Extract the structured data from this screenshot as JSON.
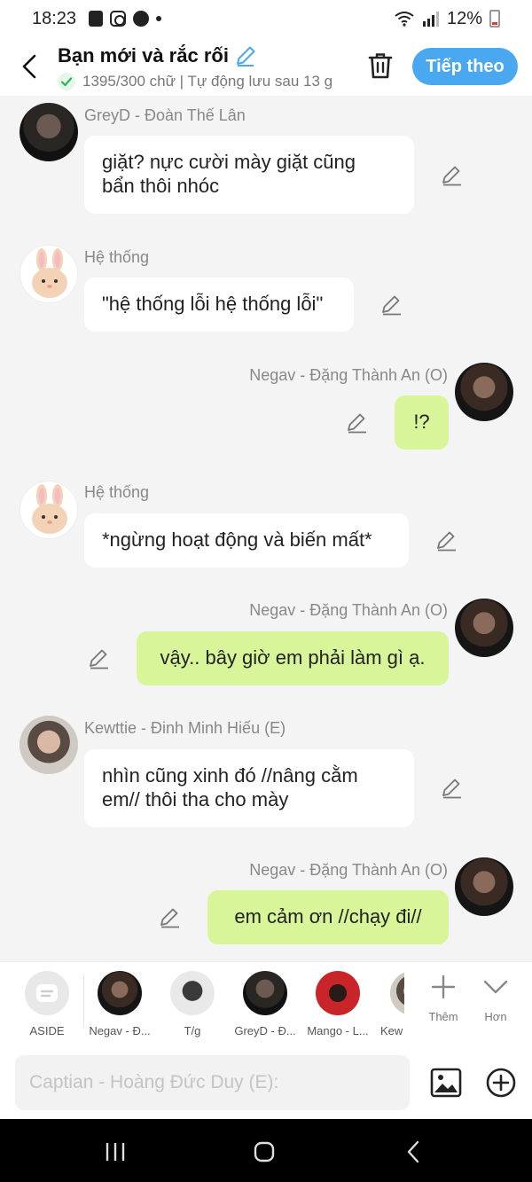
{
  "status": {
    "time": "18:23",
    "battery": "12%"
  },
  "header": {
    "title": "Bạn mới và rắc rối",
    "subtitle": "1395/300 chữ | Tự động lưu sau 13 g",
    "next_label": "Tiếp theo"
  },
  "messages": [
    {
      "sender": "GreyD - Đoàn Thế Lân",
      "line1": "giặt? nực cười mày giặt cũng",
      "line2": "bẩn thôi nhóc",
      "avatar": "greyd-avatar"
    },
    {
      "sender": "Hệ thống",
      "text": "\"hệ thống lỗi hệ thống lỗi\"",
      "avatar": "bunny-avatar"
    },
    {
      "sender": "Negav - Đặng Thành An (O)",
      "text": "!?",
      "avatar": "negav-avatar"
    },
    {
      "sender": "Hệ thống",
      "text": "*ngừng hoạt động và biến mất*",
      "avatar": "bunny-avatar"
    },
    {
      "sender": "Negav - Đặng Thành An (O)",
      "text": "vậy.. bây giờ em phải làm gì ạ.",
      "avatar": "negav-avatar"
    },
    {
      "sender": "Kewttie - Đinh Minh Hiếu (E)",
      "line1": "nhìn cũng xinh đó //nâng cằm",
      "line2": "em// thôi tha cho mày",
      "avatar": "kewttie-avatar"
    },
    {
      "sender": "Negav - Đặng Thành An (O)",
      "text": "em cảm ơn //chạy đi//",
      "avatar": "negav-avatar"
    }
  ],
  "characters": [
    {
      "label": "ASIDE"
    },
    {
      "label": "Negav - Đ..."
    },
    {
      "label": "T/g"
    },
    {
      "label": "GreyD - Đ..."
    },
    {
      "label": "Mango - L..."
    },
    {
      "label": "Kew"
    }
  ],
  "actions": {
    "add_label": "Thêm",
    "more_label": "Hơn"
  },
  "composer": {
    "placeholder": "Captian - Hoàng Đức Duy (E):"
  },
  "colors": {
    "accent": "#4aa8f0",
    "my_bubble": "#d8f59a",
    "background": "#f4f4f4"
  }
}
